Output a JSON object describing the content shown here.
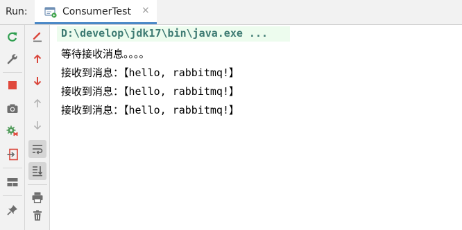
{
  "header": {
    "run_label": "Run:",
    "tab": {
      "label": "ConsumerTest",
      "close": "×"
    }
  },
  "toolbars": {
    "left": [
      {
        "name": "rerun-icon"
      },
      {
        "name": "wrench-icon"
      },
      {
        "name": "stop-icon"
      },
      {
        "name": "camera-icon"
      },
      {
        "name": "debug-cog-icon"
      },
      {
        "name": "exit-icon"
      },
      {
        "name": "layout-icon"
      },
      {
        "name": "pin-icon"
      }
    ],
    "right": [
      {
        "name": "clear-console-icon"
      },
      {
        "name": "arrow-up-red-icon"
      },
      {
        "name": "arrow-down-red-icon"
      },
      {
        "name": "arrow-up-gray-icon"
      },
      {
        "name": "arrow-down-gray-icon"
      },
      {
        "name": "soft-wrap-icon",
        "active": true
      },
      {
        "name": "scroll-to-end-icon",
        "active": true
      },
      {
        "name": "print-icon"
      },
      {
        "name": "trash-icon"
      }
    ]
  },
  "console": {
    "command": "D:\\develop\\jdk17\\bin\\java.exe ...",
    "lines": [
      "等待接收消息。。。。",
      "接收到消息：【hello, rabbitmq!】",
      "接收到消息：【hello, rabbitmq!】",
      "接收到消息：【hello, rabbitmq!】"
    ]
  },
  "colors": {
    "command_text": "#3d7a72",
    "command_bg": "#edfcee",
    "rerun_green": "#2e9e4f",
    "stop_red": "#e0483c",
    "arrow_red": "#d9453a",
    "tab_underline": "#4a88c7"
  }
}
